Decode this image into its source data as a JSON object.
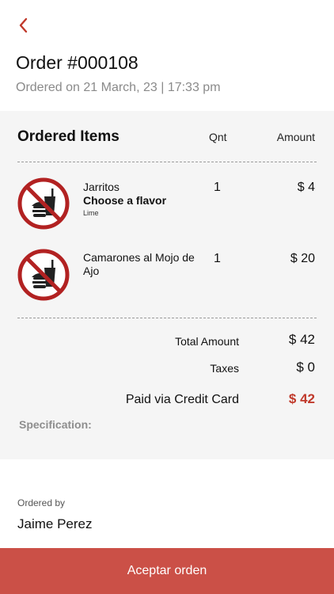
{
  "header": {
    "back_icon": "chevron-left-icon",
    "title": "Order #000108",
    "subtitle": "Ordered on 21 March, 23 | 17:33 pm"
  },
  "items_section": {
    "heading": "Ordered Items",
    "qnt_header": "Qnt",
    "amount_header": "Amount",
    "items": [
      {
        "icon": "no-food-drink-icon",
        "name": "Jarritos",
        "option_label": "Choose a flavor",
        "option_value": "Lime",
        "qty": "1",
        "amount": "$ 4"
      },
      {
        "icon": "no-food-drink-icon",
        "name": "Camarones al Mojo de Ajo",
        "option_label": "",
        "option_value": "",
        "qty": "1",
        "amount": "$ 20"
      }
    ]
  },
  "summary": {
    "total_label": "Total Amount",
    "total_value": "$ 42",
    "taxes_label": "Taxes",
    "taxes_value": "$ 0",
    "paid_label": "Paid via Credit Card",
    "paid_value": "$ 42",
    "specification_label": "Specification:"
  },
  "ordered_by": {
    "label": "Ordered by",
    "name": "Jaime Perez"
  },
  "actions": {
    "accept_label": "Aceptar orden"
  },
  "colors": {
    "accent": "#cb5047",
    "paid_value": "#c0392b",
    "icon_red": "#b22222",
    "card_bg": "#f5f5f5"
  }
}
